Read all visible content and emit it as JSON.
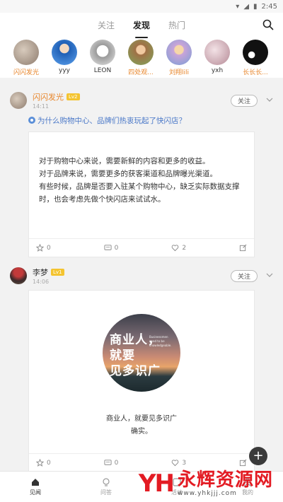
{
  "status": {
    "time": "2:45"
  },
  "tabs": [
    {
      "label": "关注"
    },
    {
      "label": "发现"
    },
    {
      "label": "热门"
    }
  ],
  "stories": [
    {
      "name": "闪闪发光",
      "highlight": true,
      "color": "#b8a89a"
    },
    {
      "name": "yyy",
      "highlight": false,
      "color": "#3d7fd6"
    },
    {
      "name": "LEON",
      "highlight": false,
      "color": "#d8d8d8"
    },
    {
      "name": "四处观...",
      "highlight": true,
      "color": "#8aa96a"
    },
    {
      "name": "刘翔lili",
      "highlight": true,
      "color": "#c9a4d8"
    },
    {
      "name": "yxh",
      "highlight": false,
      "color": "#c08a9a"
    },
    {
      "name": "长长长...",
      "highlight": true,
      "color": "#222222"
    }
  ],
  "posts": [
    {
      "name": "闪闪发光",
      "level": "Lv2",
      "time": "14:11",
      "follow": "关注",
      "topic": "为什么购物中心、品牌们热衷玩起了快闪店？",
      "lines": [
        "对于购物中心来说，需要新鲜的内容和更多的收益。",
        "对于品牌来说，需要更多的获客渠道和品牌曝光渠道。",
        "有些时候，品牌是否要入驻某个购物中心，缺乏实际数据支撑",
        "时，也会考虑先做个快闪店来试试水。"
      ],
      "actions": {
        "favorite": "0",
        "comment": "0",
        "like": "2"
      }
    },
    {
      "name": "李梦",
      "level": "Lv1",
      "time": "14:06",
      "follow": "关注",
      "image_text": [
        "商业人，",
        "就要",
        "见多识广"
      ],
      "image_small": "Businessmen need to be knowledgeable.",
      "caption": [
        "商业人，就要见多识广",
        "确实。"
      ],
      "actions": {
        "favorite": "0",
        "comment": "0",
        "like": "3"
      }
    }
  ],
  "bottom_nav": [
    {
      "label": "见闻"
    },
    {
      "label": "问答"
    },
    {
      "label": "活动"
    },
    {
      "label": "我的"
    }
  ],
  "watermark": {
    "logo": "YH",
    "title": "永辉资源网",
    "url": "www.yhkjjj.com"
  }
}
